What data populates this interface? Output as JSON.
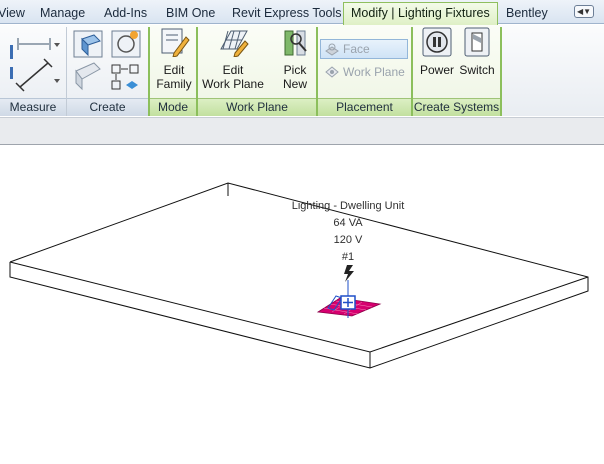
{
  "tabs": [
    {
      "label": "View"
    },
    {
      "label": "Manage"
    },
    {
      "label": "Add-Ins"
    },
    {
      "label": "BIM One"
    },
    {
      "label": "Revit Express Tools"
    },
    {
      "label": "Modify | Lighting Fixtures",
      "active": true
    },
    {
      "label": "Bentley"
    }
  ],
  "ribbon": {
    "panels": {
      "measure": "Measure",
      "create": "Create",
      "mode": "Mode",
      "work_plane": "Work Plane",
      "placement": "Placement",
      "create_systems": "Create Systems"
    },
    "tools": {
      "edit_family_line1": "Edit",
      "edit_family_line2": "Family",
      "edit_work_plane_line1": "Edit",
      "edit_work_plane_line2": "Work Plane",
      "pick_new_line1": "Pick",
      "pick_new_line2": "New",
      "power": "Power",
      "switch": "Switch"
    },
    "placement": {
      "face": "Face",
      "work_plane": "Work Plane"
    }
  },
  "canvas": {
    "tag": {
      "line1": "Lighting - Dwelling Unit",
      "line2": "64 VA",
      "line3": "120 V",
      "line4": "#1"
    }
  },
  "colors": {
    "context_tab": "#dff0c6",
    "fixture": "#d6006f",
    "grip": "#1e4fc8"
  }
}
